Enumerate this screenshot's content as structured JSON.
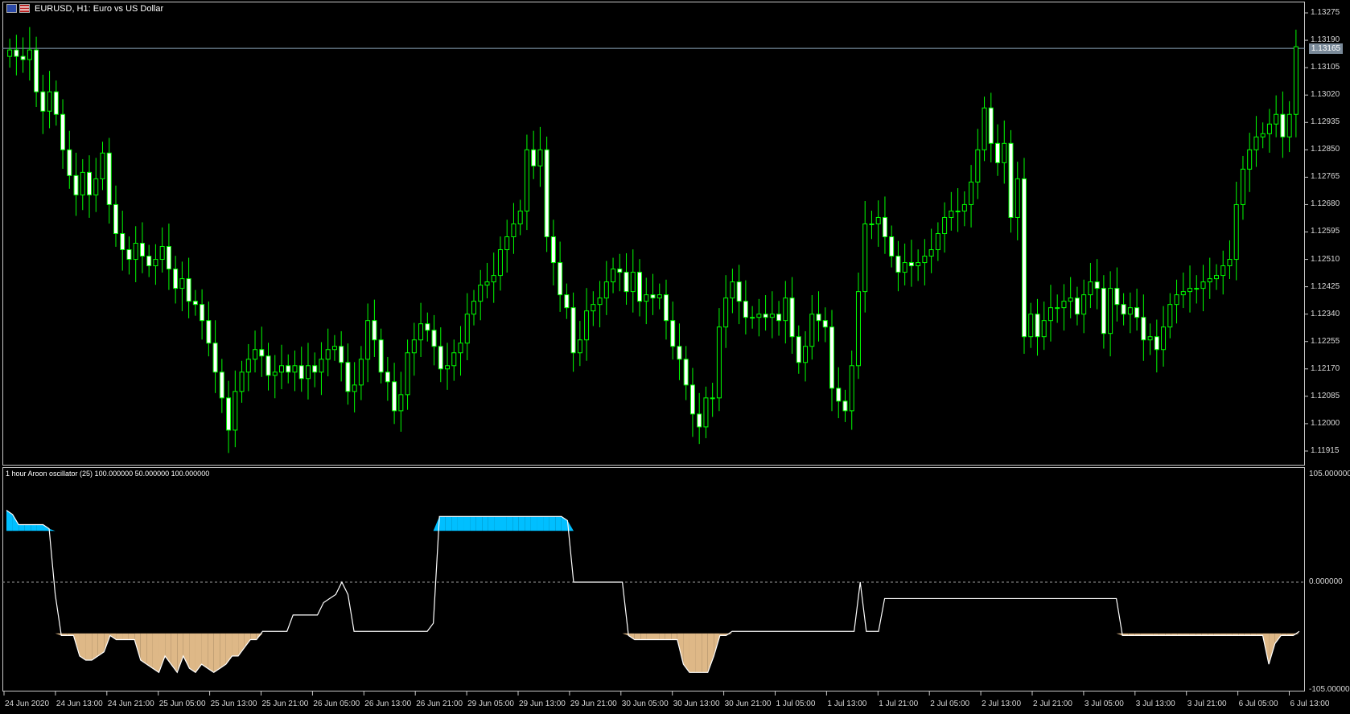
{
  "window": {
    "symbol_title": "EURUSD, H1:  Euro vs US Dollar",
    "indicator_title": "1 hour Aroon oscillator (25) 100.000000 50.000000 100.000000"
  },
  "icons": [
    "eu-flag-icon",
    "us-flag-icon"
  ],
  "colors": {
    "background": "#000000",
    "bull_candle": "#00ff00",
    "bear_candle_body": "#ffffff",
    "bid_line": "#8aa4b8",
    "aroon_line": "#ffffff",
    "aroon_up_fill": "#00bfff",
    "aroon_down_fill": "#deb887"
  },
  "price_axis": {
    "labels": [
      "1.13275",
      "1.13190",
      "1.13105",
      "1.13020",
      "1.12935",
      "1.12850",
      "1.12765",
      "1.12680",
      "1.12595",
      "1.12510",
      "1.12425",
      "1.12340",
      "1.12255",
      "1.12170",
      "1.12085",
      "1.12000",
      "1.11915"
    ],
    "current_price": "1.13165",
    "range": [
      1.1188,
      1.133
    ]
  },
  "indicator_axis": {
    "labels": [
      "105.000000",
      "0.000000",
      "-105.000000"
    ],
    "range": [
      -105,
      105
    ],
    "zero_level": 0
  },
  "time_axis": {
    "labels": [
      "24 Jun 2020",
      "24 Jun 13:00",
      "24 Jun 21:00",
      "25 Jun 05:00",
      "25 Jun 13:00",
      "25 Jun 21:00",
      "26 Jun 05:00",
      "26 Jun 13:00",
      "26 Jun 21:00",
      "29 Jun 05:00",
      "29 Jun 13:00",
      "29 Jun 21:00",
      "30 Jun 05:00",
      "30 Jun 13:00",
      "30 Jun 21:00",
      "1 Jul 05:00",
      "1 Jul 13:00",
      "1 Jul 21:00",
      "2 Jul 05:00",
      "2 Jul 13:00",
      "2 Jul 21:00",
      "3 Jul 05:00",
      "3 Jul 13:00",
      "3 Jul 21:00",
      "6 Jul 05:00",
      "6 Jul 13:00"
    ]
  },
  "chart_data": [
    {
      "type": "candlestick",
      "title": "EURUSD, H1:  Euro vs US Dollar",
      "ylim": [
        1.1188,
        1.133
      ],
      "closes": [
        1.1316,
        1.1314,
        1.1313,
        1.1316,
        1.1303,
        1.1297,
        1.1303,
        1.1296,
        1.1285,
        1.1277,
        1.1271,
        1.1278,
        1.1271,
        1.1276,
        1.1284,
        1.1268,
        1.1259,
        1.1254,
        1.1251,
        1.1256,
        1.1252,
        1.1249,
        1.1251,
        1.1255,
        1.1248,
        1.1242,
        1.1245,
        1.1238,
        1.1237,
        1.1232,
        1.1225,
        1.1216,
        1.1208,
        1.1198,
        1.121,
        1.1216,
        1.122,
        1.1223,
        1.1221,
        1.1215,
        1.1216,
        1.1218,
        1.1216,
        1.1218,
        1.1214,
        1.1218,
        1.1216,
        1.122,
        1.1223,
        1.1224,
        1.1219,
        1.121,
        1.1212,
        1.122,
        1.1232,
        1.1226,
        1.1216,
        1.1213,
        1.1204,
        1.1209,
        1.1222,
        1.1226,
        1.1231,
        1.1229,
        1.1224,
        1.1217,
        1.1218,
        1.1222,
        1.1225,
        1.1234,
        1.1238,
        1.1243,
        1.1244,
        1.1246,
        1.1254,
        1.1258,
        1.1262,
        1.1266,
        1.1285,
        1.128,
        1.1285,
        1.1258,
        1.125,
        1.124,
        1.1236,
        1.1222,
        1.1226,
        1.1235,
        1.1237,
        1.1239,
        1.1244,
        1.1248,
        1.1247,
        1.1241,
        1.1247,
        1.1238,
        1.124,
        1.1239,
        1.124,
        1.1232,
        1.1224,
        1.122,
        1.1212,
        1.1203,
        1.1199,
        1.1208,
        1.1208,
        1.123,
        1.1239,
        1.1244,
        1.1238,
        1.1233,
        1.1233,
        1.1234,
        1.1233,
        1.1234,
        1.1232,
        1.1239,
        1.1227,
        1.1219,
        1.1224,
        1.1234,
        1.1232,
        1.123,
        1.1211,
        1.1207,
        1.1204,
        1.1218,
        1.1241,
        1.1262,
        1.1262,
        1.1264,
        1.1258,
        1.1252,
        1.1247,
        1.125,
        1.1249,
        1.125,
        1.1252,
        1.1254,
        1.1259,
        1.1264,
        1.1266,
        1.1266,
        1.1268,
        1.1275,
        1.1285,
        1.1298,
        1.1287,
        1.1281,
        1.1287,
        1.1264,
        1.1276,
        1.1227,
        1.1234,
        1.1227,
        1.1232,
        1.1236,
        1.1236,
        1.1238,
        1.1239,
        1.1234,
        1.124,
        1.1244,
        1.1242,
        1.1228,
        1.1242,
        1.1237,
        1.1234,
        1.1236,
        1.1233,
        1.1226,
        1.1227,
        1.1223,
        1.123,
        1.1237,
        1.124,
        1.1241,
        1.1242,
        1.1242,
        1.1244,
        1.1245,
        1.1246,
        1.1249,
        1.1251,
        1.1268,
        1.1279,
        1.1285,
        1.1289,
        1.129,
        1.1293,
        1.1296,
        1.1289,
        1.1296,
        1.1317
      ]
    },
    {
      "type": "area",
      "title": "1 hour Aroon oscillator (25) 100.000000 50.000000 100.000000",
      "ylim": [
        -105,
        105
      ],
      "baseline": 0,
      "x": [
        0,
        1,
        2,
        3,
        4,
        5,
        6,
        7,
        8,
        9,
        10,
        11,
        12,
        13,
        14,
        15,
        16,
        17,
        18,
        19,
        20,
        21,
        22,
        23,
        24,
        25,
        26,
        27,
        28,
        29,
        30,
        31,
        32,
        33,
        34,
        35,
        36,
        37,
        38,
        39,
        40,
        41,
        42,
        43,
        44,
        45,
        46,
        47,
        48,
        49,
        50,
        51,
        52,
        53,
        54,
        55,
        56,
        57,
        58,
        59,
        60,
        61,
        62,
        63,
        64,
        65,
        66,
        67,
        68,
        69,
        70,
        71,
        72,
        73,
        74,
        75,
        76,
        77,
        78,
        79,
        80,
        81,
        82,
        83,
        84,
        85,
        86,
        87,
        88,
        89,
        90,
        91,
        92,
        93,
        94,
        95,
        96,
        97,
        98,
        99,
        100,
        101,
        102,
        103,
        104,
        105,
        106,
        107,
        108,
        109,
        110,
        111,
        112,
        113,
        114,
        115,
        116,
        117,
        118,
        119,
        120,
        121,
        122,
        123,
        124,
        125,
        126,
        127,
        128,
        129,
        130,
        131,
        132,
        133,
        134,
        135,
        136,
        137,
        138,
        139,
        140,
        141,
        142,
        143,
        144,
        145,
        146,
        147,
        148,
        149,
        150,
        151,
        152,
        153,
        154,
        155,
        156,
        157,
        158,
        159,
        160,
        161,
        162,
        163,
        164,
        165,
        166,
        167,
        168,
        169,
        170,
        171,
        172,
        173,
        174,
        175,
        176,
        177,
        178,
        179,
        180,
        181,
        182,
        183,
        184,
        185,
        186,
        187,
        188,
        189,
        190,
        191,
        192,
        193,
        194,
        195,
        196,
        197,
        198
      ],
      "values": [
        70,
        66,
        56,
        56,
        56,
        56,
        56,
        52,
        -12,
        -52,
        -52,
        -52,
        -72,
        -76,
        -76,
        -72,
        -68,
        -52,
        -56,
        -56,
        -56,
        -56,
        -76,
        -80,
        -84,
        -88,
        -72,
        -80,
        -88,
        -72,
        -84,
        -88,
        -80,
        -84,
        -88,
        -84,
        -80,
        -72,
        -72,
        -64,
        -56,
        -56,
        -48,
        -48,
        -48,
        -48,
        -48,
        -32,
        -32,
        -32,
        -32,
        -32,
        -20,
        -16,
        -12,
        0,
        -12,
        -48,
        -48,
        -48,
        -48,
        -48,
        -48,
        -48,
        -48,
        -48,
        -48,
        -48,
        -48,
        -48,
        -40,
        64,
        64,
        64,
        64,
        64,
        64,
        64,
        64,
        64,
        64,
        64,
        64,
        64,
        64,
        64,
        64,
        64,
        64,
        64,
        64,
        64,
        60,
        0,
        0,
        0,
        0,
        0,
        0,
        0,
        0,
        0,
        -52,
        -56,
        -56,
        -56,
        -56,
        -56,
        -56,
        -56,
        -56,
        -80,
        -88,
        -88,
        -88,
        -88,
        -72,
        -52,
        -52,
        -48,
        -48,
        -48,
        -48,
        -48,
        -48,
        -48,
        -48,
        -48,
        -48,
        -48,
        -48,
        -48,
        -48,
        -48,
        -48,
        -48,
        -48,
        -48,
        -48,
        -48,
        0,
        -48,
        -48,
        -48,
        -16,
        -16,
        -16,
        -16,
        -16,
        -16,
        -16,
        -16,
        -16,
        -16,
        -16,
        -16,
        -16,
        -16,
        -16,
        -16,
        -16,
        -16,
        -16,
        -16,
        -16,
        -16,
        -16,
        -16,
        -16,
        -16,
        -16,
        -16,
        -16,
        -16,
        -16,
        -16,
        -16,
        -16,
        -16,
        -16,
        -16,
        -16,
        -16,
        -52,
        -52,
        -52,
        -52,
        -52,
        -52,
        -52,
        -52,
        -52,
        -52,
        -52,
        -52,
        -52,
        -52,
        -52,
        -52,
        -52,
        -52,
        -52,
        -52,
        -52,
        -52,
        -52,
        -52,
        -80,
        -60,
        -52,
        -52,
        -52,
        -48
      ]
    }
  ]
}
